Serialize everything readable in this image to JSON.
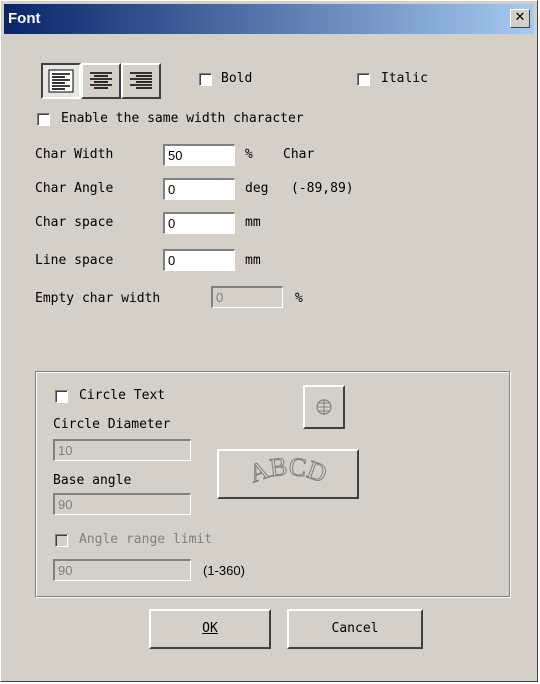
{
  "window": {
    "title": "Font",
    "close_icon": "close-icon"
  },
  "alignment": {
    "buttons": [
      {
        "icon": "align-left-icon",
        "pressed": true
      },
      {
        "icon": "align-center-icon",
        "pressed": false
      },
      {
        "icon": "align-right-icon",
        "pressed": false
      }
    ]
  },
  "bold": {
    "label": "Bold",
    "checked": false
  },
  "italic": {
    "label": "Italic",
    "checked": false
  },
  "same_width": {
    "label": "Enable the same width character",
    "checked": false
  },
  "char_width": {
    "label": "Char Width",
    "value": "50",
    "unit": "%",
    "suffix": "Char"
  },
  "char_angle": {
    "label": "Char Angle",
    "value": "0",
    "unit": "deg",
    "range": "(-89,89)"
  },
  "char_space": {
    "label": "Char space",
    "value": "0",
    "unit": "mm"
  },
  "line_space": {
    "label": "Line space",
    "value": "0",
    "unit": "mm"
  },
  "empty_char": {
    "label": "Empty char width",
    "value": "0",
    "unit": "%"
  },
  "circle": {
    "circle_text_label": "Circle Text",
    "diameter_label": "Circle Diameter",
    "diameter_value": "10",
    "base_angle_label": "Base angle",
    "base_angle_value": "90",
    "angle_limit_label": "Angle range limit",
    "angle_limit_value": "90",
    "angle_limit_range": "(1-360)",
    "preview_text": "ABCD"
  },
  "buttons": {
    "ok": "OK",
    "cancel": "Cancel"
  }
}
